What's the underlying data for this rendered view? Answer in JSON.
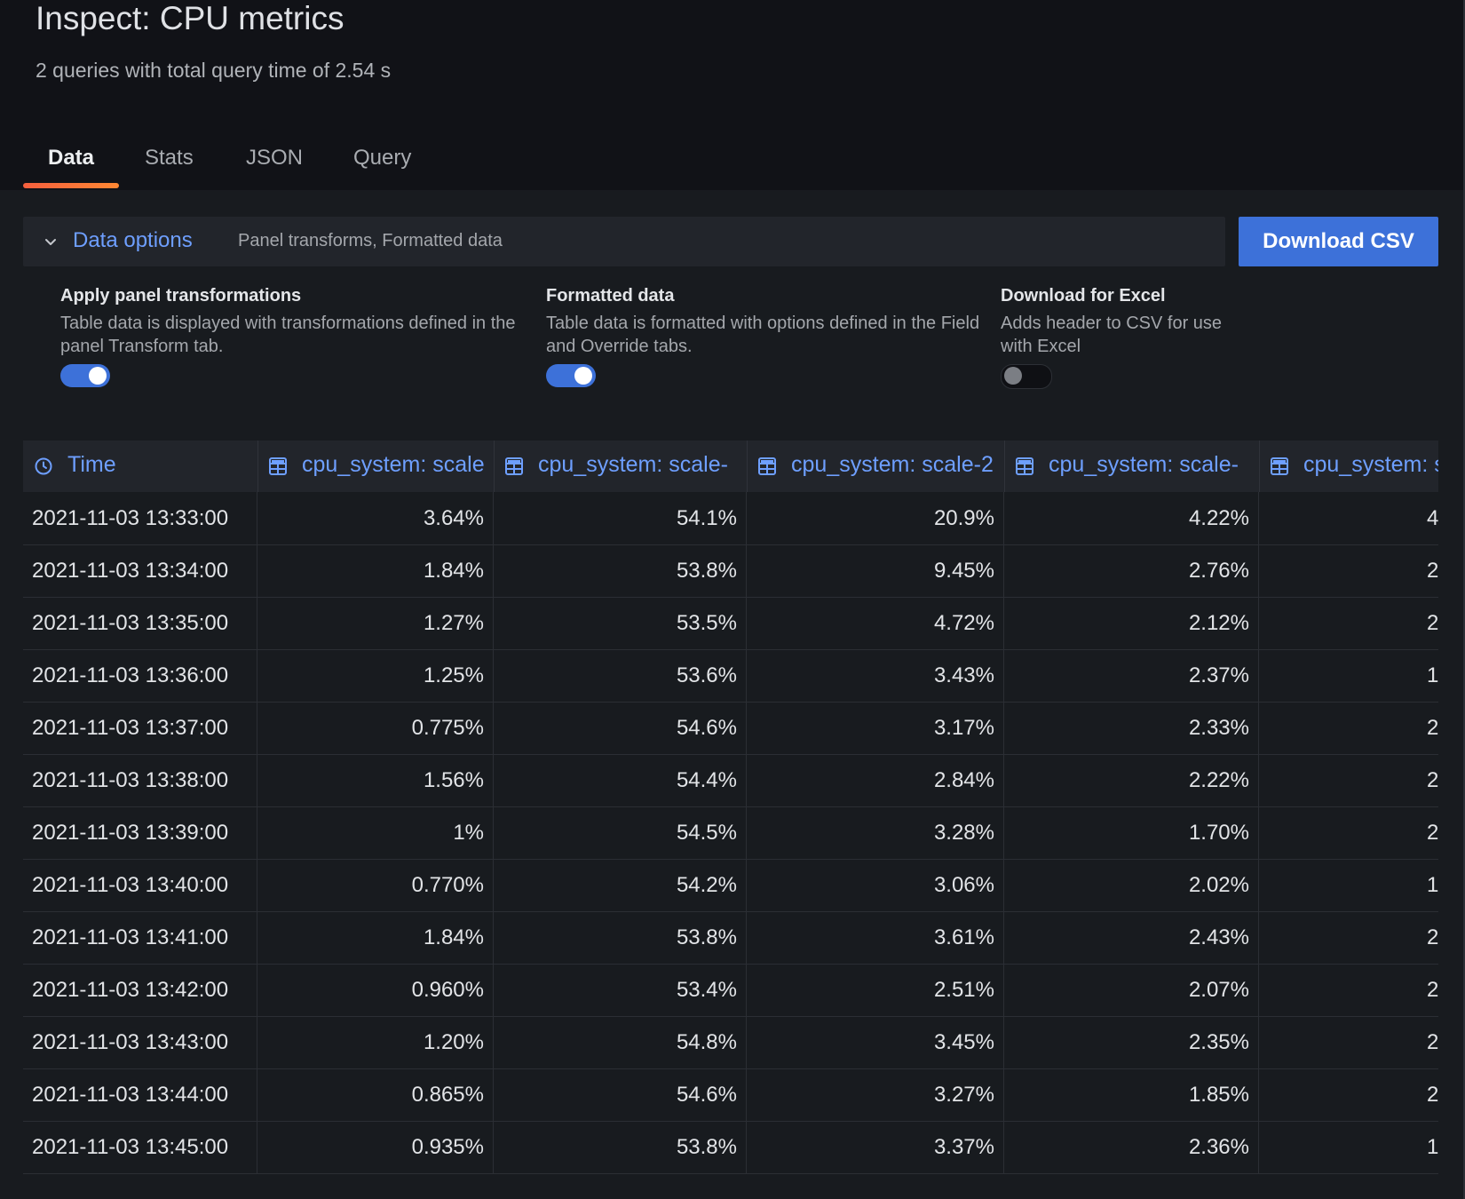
{
  "header": {
    "title": "Inspect: CPU metrics",
    "subtitle": "2 queries with total query time of 2.54 s"
  },
  "tabs": [
    {
      "label": "Data",
      "active": true
    },
    {
      "label": "Stats",
      "active": false
    },
    {
      "label": "JSON",
      "active": false
    },
    {
      "label": "Query",
      "active": false
    }
  ],
  "data_options": {
    "title": "Data options",
    "summary": "Panel transforms, Formatted data",
    "download_label": "Download CSV",
    "options": [
      {
        "label": "Apply panel transformations",
        "description": "Table data is displayed with transformations defined in the panel Transform tab.",
        "enabled": true
      },
      {
        "label": "Formatted data",
        "description": "Table data is formatted with options defined in the Field and Override tabs.",
        "enabled": true
      },
      {
        "label": "Download for Excel",
        "description": "Adds header to CSV for use with Excel",
        "enabled": false
      }
    ]
  },
  "colors": {
    "accent": "#3d71d9",
    "link": "#6e9fff",
    "tab_underline": "#ff7733"
  },
  "table": {
    "columns": [
      {
        "label": "Time",
        "icon": "clock-icon"
      },
      {
        "label": "cpu_system: scale",
        "icon": "table-icon"
      },
      {
        "label": "cpu_system: scale-",
        "icon": "table-icon"
      },
      {
        "label": "cpu_system: scale-2",
        "icon": "table-icon"
      },
      {
        "label": "cpu_system: scale-",
        "icon": "table-icon"
      },
      {
        "label": "cpu_system: s",
        "icon": "table-icon"
      }
    ],
    "rows": [
      [
        "2021-11-03 13:33:00",
        "3.64%",
        "54.1%",
        "20.9%",
        "4.22%",
        "4."
      ],
      [
        "2021-11-03 13:34:00",
        "1.84%",
        "53.8%",
        "9.45%",
        "2.76%",
        "2."
      ],
      [
        "2021-11-03 13:35:00",
        "1.27%",
        "53.5%",
        "4.72%",
        "2.12%",
        "2."
      ],
      [
        "2021-11-03 13:36:00",
        "1.25%",
        "53.6%",
        "3.43%",
        "2.37%",
        "1."
      ],
      [
        "2021-11-03 13:37:00",
        "0.775%",
        "54.6%",
        "3.17%",
        "2.33%",
        "2."
      ],
      [
        "2021-11-03 13:38:00",
        "1.56%",
        "54.4%",
        "2.84%",
        "2.22%",
        "2."
      ],
      [
        "2021-11-03 13:39:00",
        "1%",
        "54.5%",
        "3.28%",
        "1.70%",
        "2."
      ],
      [
        "2021-11-03 13:40:00",
        "0.770%",
        "54.2%",
        "3.06%",
        "2.02%",
        "1."
      ],
      [
        "2021-11-03 13:41:00",
        "1.84%",
        "53.8%",
        "3.61%",
        "2.43%",
        "2."
      ],
      [
        "2021-11-03 13:42:00",
        "0.960%",
        "53.4%",
        "2.51%",
        "2.07%",
        "2."
      ],
      [
        "2021-11-03 13:43:00",
        "1.20%",
        "54.8%",
        "3.45%",
        "2.35%",
        "2."
      ],
      [
        "2021-11-03 13:44:00",
        "0.865%",
        "54.6%",
        "3.27%",
        "1.85%",
        "2."
      ],
      [
        "2021-11-03 13:45:00",
        "0.935%",
        "53.8%",
        "3.37%",
        "2.36%",
        "1."
      ]
    ]
  }
}
